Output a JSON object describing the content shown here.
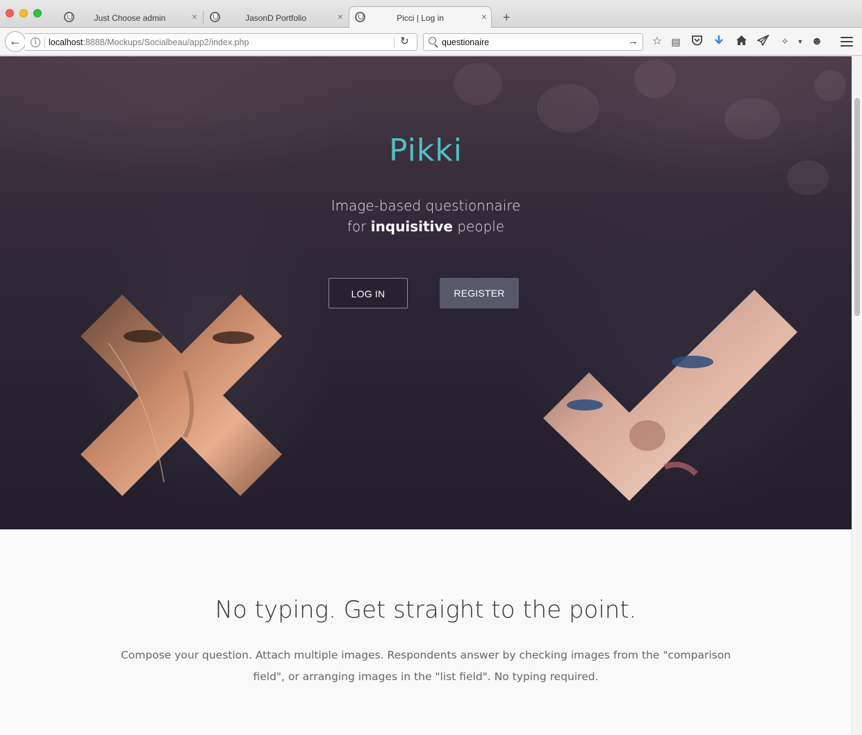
{
  "browser": {
    "tabs": [
      {
        "title": "Just Choose admin"
      },
      {
        "title": "JasonD Portfolio"
      },
      {
        "title": "Picci | Log in"
      }
    ],
    "url": {
      "host": "localhost",
      "path": ":8888/Mockups/Socialbeau/app2/index.php"
    },
    "search": {
      "value": "questionaire"
    },
    "toolbar_icons": [
      "star-icon",
      "reading-list-icon",
      "pocket-icon",
      "download-icon",
      "home-icon",
      "send-icon",
      "extension-icon",
      "emoji-icon",
      "menu-icon"
    ]
  },
  "hero": {
    "logo": "Pikki",
    "tagline_line1": "Image-based questionnaire",
    "tagline_line2_prefix": "for ",
    "tagline_line2_bold": "inquisitive",
    "tagline_line2_suffix": " people",
    "login_label": "LOG IN",
    "register_label": "REGISTER"
  },
  "features": {
    "title": "No typing. Get straight to the point.",
    "text": "Compose your question. Attach multiple images. Respondents answer by checking images from the \"comparison field\", or arranging images in the \"list field\". No typing required."
  },
  "colors": {
    "accent": "#4ec0c2",
    "register_button": "#575868",
    "hero_bg": "#2c2636"
  }
}
